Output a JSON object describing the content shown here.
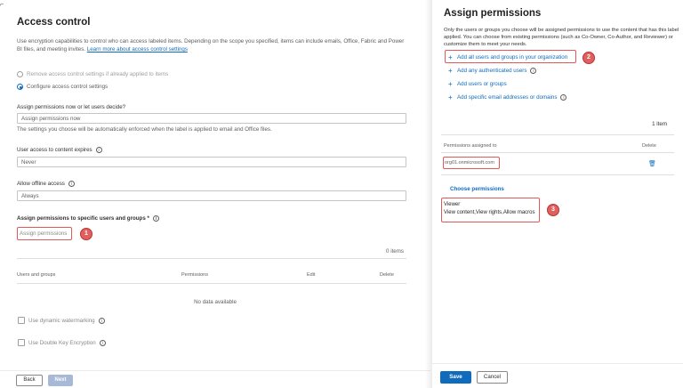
{
  "left": {
    "title": "Access control",
    "intro_text": "Use encryption capabilities to control who can access labeled items. Depending on the scope you specified, items can include emails, Office, Fabric and Power BI files, and meeting invites.",
    "intro_link": "Learn more about access control settings",
    "radio_remove": "Remove access control settings if already applied to items",
    "radio_configure": "Configure access control settings",
    "assign_now_label": "Assign permissions now or let users decide?",
    "assign_now_value": "Assign permissions now",
    "assign_now_helper": "The settings you choose will be automatically enforced when the label is applied to email and Office files.",
    "expires_label": "User access to content expires",
    "expires_value": "Never",
    "offline_label": "Allow offline access",
    "offline_value": "Always",
    "specific_label": "Assign permissions to specific users and groups *",
    "assign_link": "Assign permissions",
    "items_count": "0 items",
    "table_headers": [
      "Users and groups",
      "Permissions",
      "Edit",
      "Delete"
    ],
    "no_data": "No data available",
    "dynamic_watermark": "Use dynamic watermarking",
    "double_key": "Use Double Key Encryption",
    "back_label": "Back",
    "next_label": "Next"
  },
  "panel": {
    "title": "Assign permissions",
    "description": "Only the users or groups you choose will be assigned permissions to use the content that has this label applied. You can choose from existing permissions (such as Co-Owner, Co-Author, and Reviewer) or customize them to meet your needs.",
    "actions": [
      "Add all users and groups in your organization",
      "Add any authenticated users",
      "Add users or groups",
      "Add specific email addresses or domains"
    ],
    "count": "1 item",
    "col_assigned": "Permissions assigned to",
    "col_delete": "Delete",
    "assignee": "org01.onmicrosoft.com",
    "choose_label": "Choose permissions",
    "role_name": "Viewer",
    "role_perms": "View content,View rights,Allow macros",
    "save_label": "Save",
    "cancel_label": "Cancel"
  },
  "badges": [
    "1",
    "2",
    "3"
  ],
  "colors": {
    "accent": "#0f6cbd",
    "callout": "#e05a5a"
  }
}
